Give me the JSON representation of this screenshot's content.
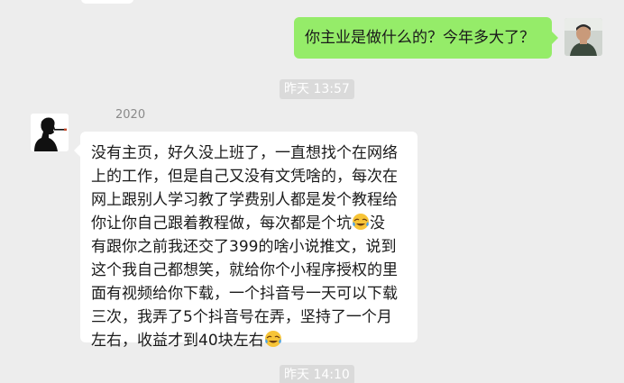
{
  "messages": {
    "outgoing_1": {
      "text": "你主业是做什么的？今年多大了？"
    },
    "incoming_1": {
      "sender_name": "2020",
      "lines": [
        [
          "没有主页，好久没上班了，一直想找个在网络"
        ],
        [
          "上的工作，但是自己又没有文凭啥的，每次在"
        ],
        [
          "网上跟别人学习教了学费别人都是发个教程给"
        ],
        [
          "你让你自己跟着教程做，每次都是个坑",
          "没"
        ],
        [
          "有跟你之前我还交了399的啥小说推文，说到"
        ],
        [
          "这个我自己都想笑，就给你个小程序授权的里"
        ],
        [
          "面有视频给你下载，一个抖音号一天可以下载"
        ],
        [
          "三次，我弄了5个抖音号在弄，坚持了一个月"
        ],
        [
          "左右，收益才到40块左右",
          ""
        ]
      ],
      "emoji": "crying-laughing-emoji"
    }
  },
  "timestamps": {
    "first": "昨天 13:57",
    "second": "昨天 14:10"
  },
  "colors": {
    "background": "#ededed",
    "outgoing_bubble": "#95ec69",
    "incoming_bubble": "#ffffff",
    "time_badge": "#dadada"
  }
}
